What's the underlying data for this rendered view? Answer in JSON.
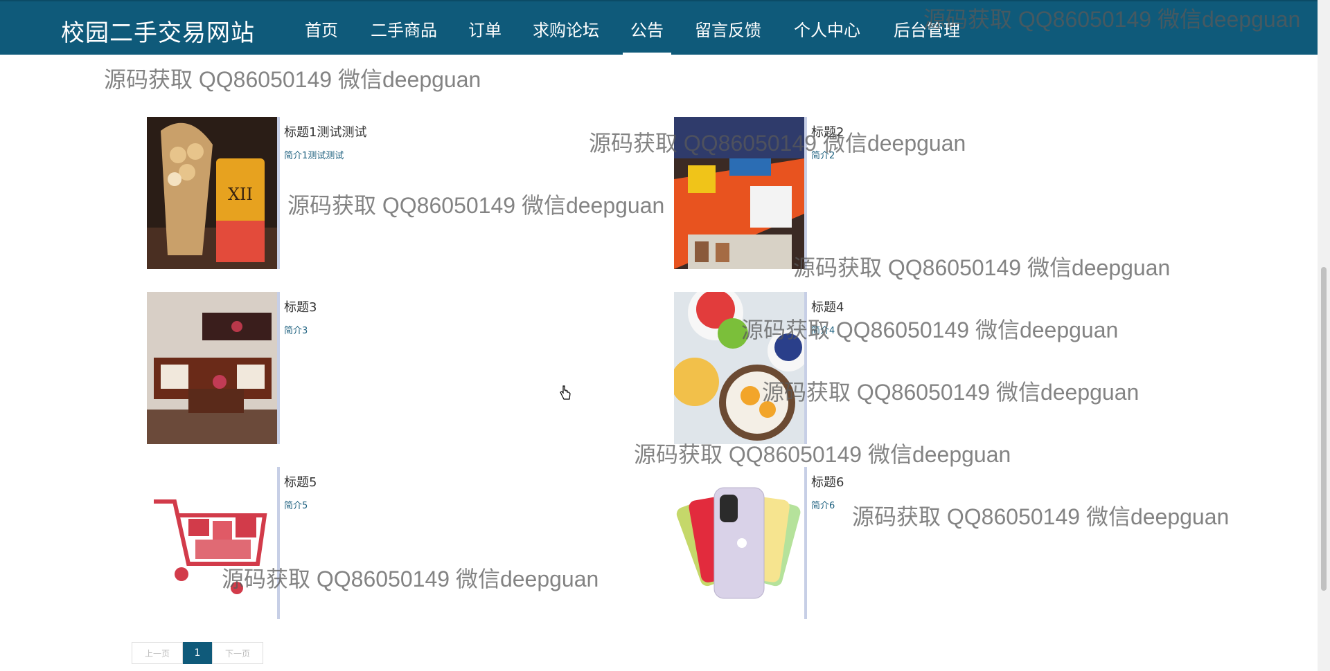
{
  "site": {
    "brand": "校园二手交易网站"
  },
  "nav": [
    {
      "label": "首页"
    },
    {
      "label": "二手商品"
    },
    {
      "label": "订单"
    },
    {
      "label": "求购论坛"
    },
    {
      "label": "公告",
      "active": true
    },
    {
      "label": "留言反馈"
    },
    {
      "label": "个人中心"
    },
    {
      "label": "后台管理"
    }
  ],
  "watermark": "源码获取 QQ86050149 微信deepguan",
  "announcements": [
    {
      "title": "标题1测试测试",
      "desc": "简介1测试测试",
      "image": "waffle-drink-image"
    },
    {
      "title": "标题2",
      "desc": "简介2",
      "image": "shop-display-image"
    },
    {
      "title": "标题3",
      "desc": "简介3",
      "image": "living-room-image"
    },
    {
      "title": "标题4",
      "desc": "简介4",
      "image": "fruit-bowls-image"
    },
    {
      "title": "标题5",
      "desc": "简介5",
      "image": "shopping-cart-image"
    },
    {
      "title": "标题6",
      "desc": "简介6",
      "image": "phones-fan-image"
    }
  ],
  "pagination": {
    "prev": "上一页",
    "current": "1",
    "next": "下一页"
  },
  "colors": {
    "nav_bg": "#0f5a7a",
    "accent": "#1b5f7e",
    "thumb_shadow": "#c7cfe6"
  }
}
